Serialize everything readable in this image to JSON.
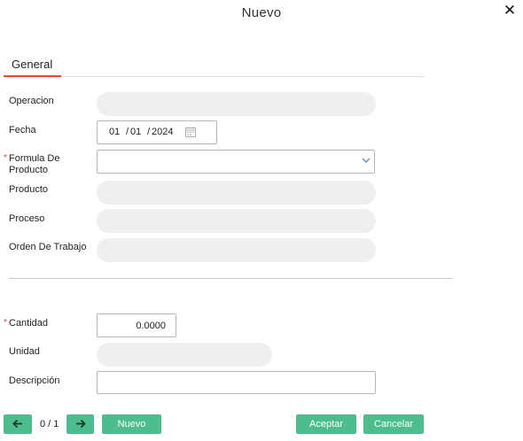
{
  "dialog": {
    "title": "Nuevo",
    "close_icon": "close-icon"
  },
  "tabs": [
    {
      "label": "General",
      "active": true
    }
  ],
  "fields": {
    "operacion": {
      "label": "Operacion",
      "value": ""
    },
    "fecha": {
      "label": "Fecha",
      "day": "01",
      "month": "01",
      "year": "2024",
      "sep": "/"
    },
    "formula": {
      "label_line1": "Formula De",
      "label_line2": "Producto",
      "required": true,
      "value": ""
    },
    "producto": {
      "label": "Producto",
      "value": ""
    },
    "proceso": {
      "label": "Proceso",
      "value": ""
    },
    "orden": {
      "label": "Orden De Trabajo",
      "value": ""
    },
    "cantidad": {
      "label": "Cantidad",
      "required": true,
      "value": "0.0000"
    },
    "unidad": {
      "label": "Unidad",
      "value": ""
    },
    "descripcion": {
      "label": "Descripción",
      "value": ""
    }
  },
  "required_marker": "*",
  "footer": {
    "prev_icon": "arrow-left-icon",
    "next_icon": "arrow-right-icon",
    "pager": "0 / 1",
    "nuevo": "Nuevo",
    "aceptar": "Aceptar",
    "cancelar": "Cancelar"
  },
  "colors": {
    "accent": "#4dbd8e",
    "tab_underline": "#e8482f",
    "required": "#e0413a",
    "readonly_bg": "#efeff1"
  }
}
